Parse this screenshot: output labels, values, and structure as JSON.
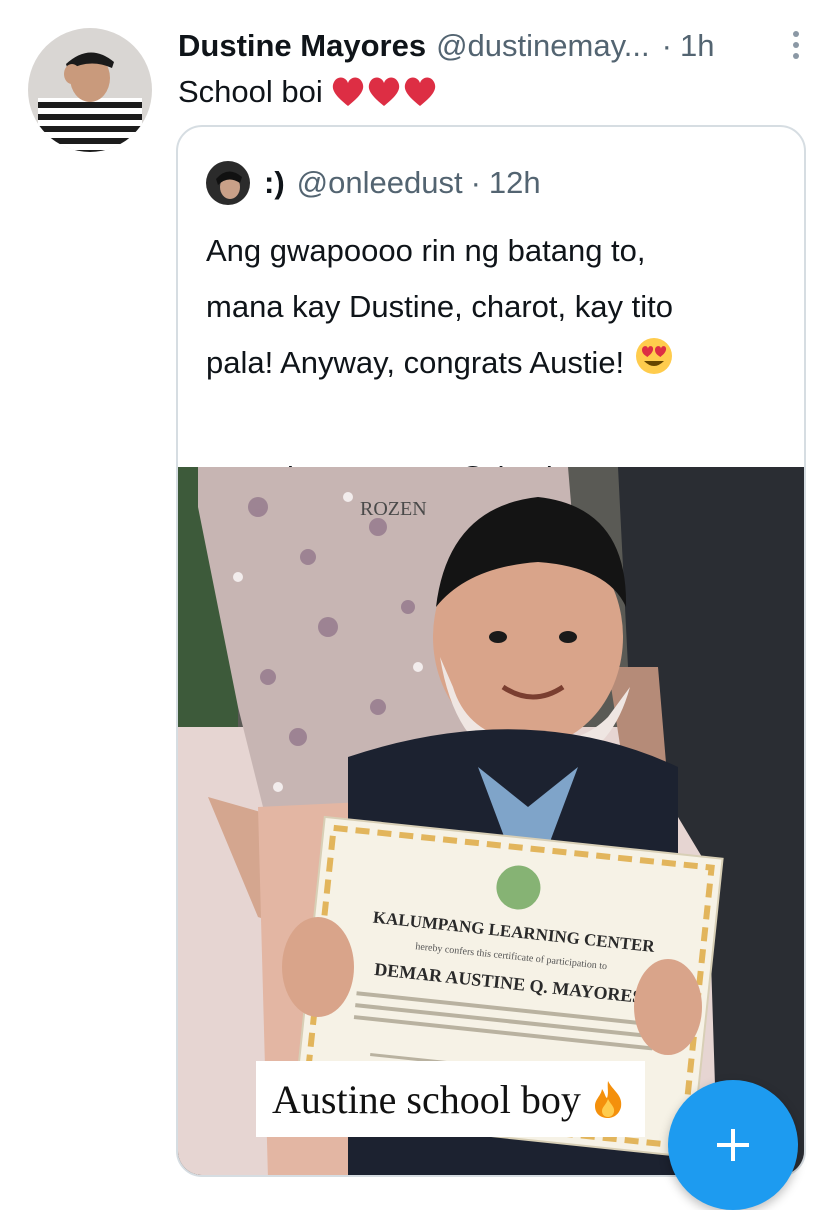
{
  "author": {
    "name": "Dustine Mayores",
    "handle": "@dustinemay...",
    "separator": "·",
    "time": "1h"
  },
  "tweet": {
    "text": "School boi",
    "emoji_count": 3,
    "emoji_icon": "red-heart-icon"
  },
  "quoted": {
    "name": ":)",
    "handle": "@onleedust",
    "separator": "·",
    "time": "12h",
    "lines": [
      "Ang gwapoooo rin ng batang to,",
      "mana kay Dustine, charot, kay tito",
      "pala! Anyway, congrats Austie!"
    ],
    "tags": "#DustineMayores @dustinemayore..."
  },
  "photo": {
    "caption": "Austine school boy",
    "certificate_title": "KALUMPANG LEARNING CENTER",
    "certificate_subtitle": "hereby confers this certificate of participation to",
    "certificate_name": "DEMAR AUSTINE Q. MAYORES",
    "shirt_text": "ROZEN",
    "colors": {
      "wall": "#e8d8d6",
      "shirt_left": "#c9b8b6",
      "boy_shirt": "#1a1f2b",
      "adult_right": "#2a2d33"
    }
  },
  "fab": {
    "icon": "plus-icon",
    "color": "#1d9bf0"
  }
}
